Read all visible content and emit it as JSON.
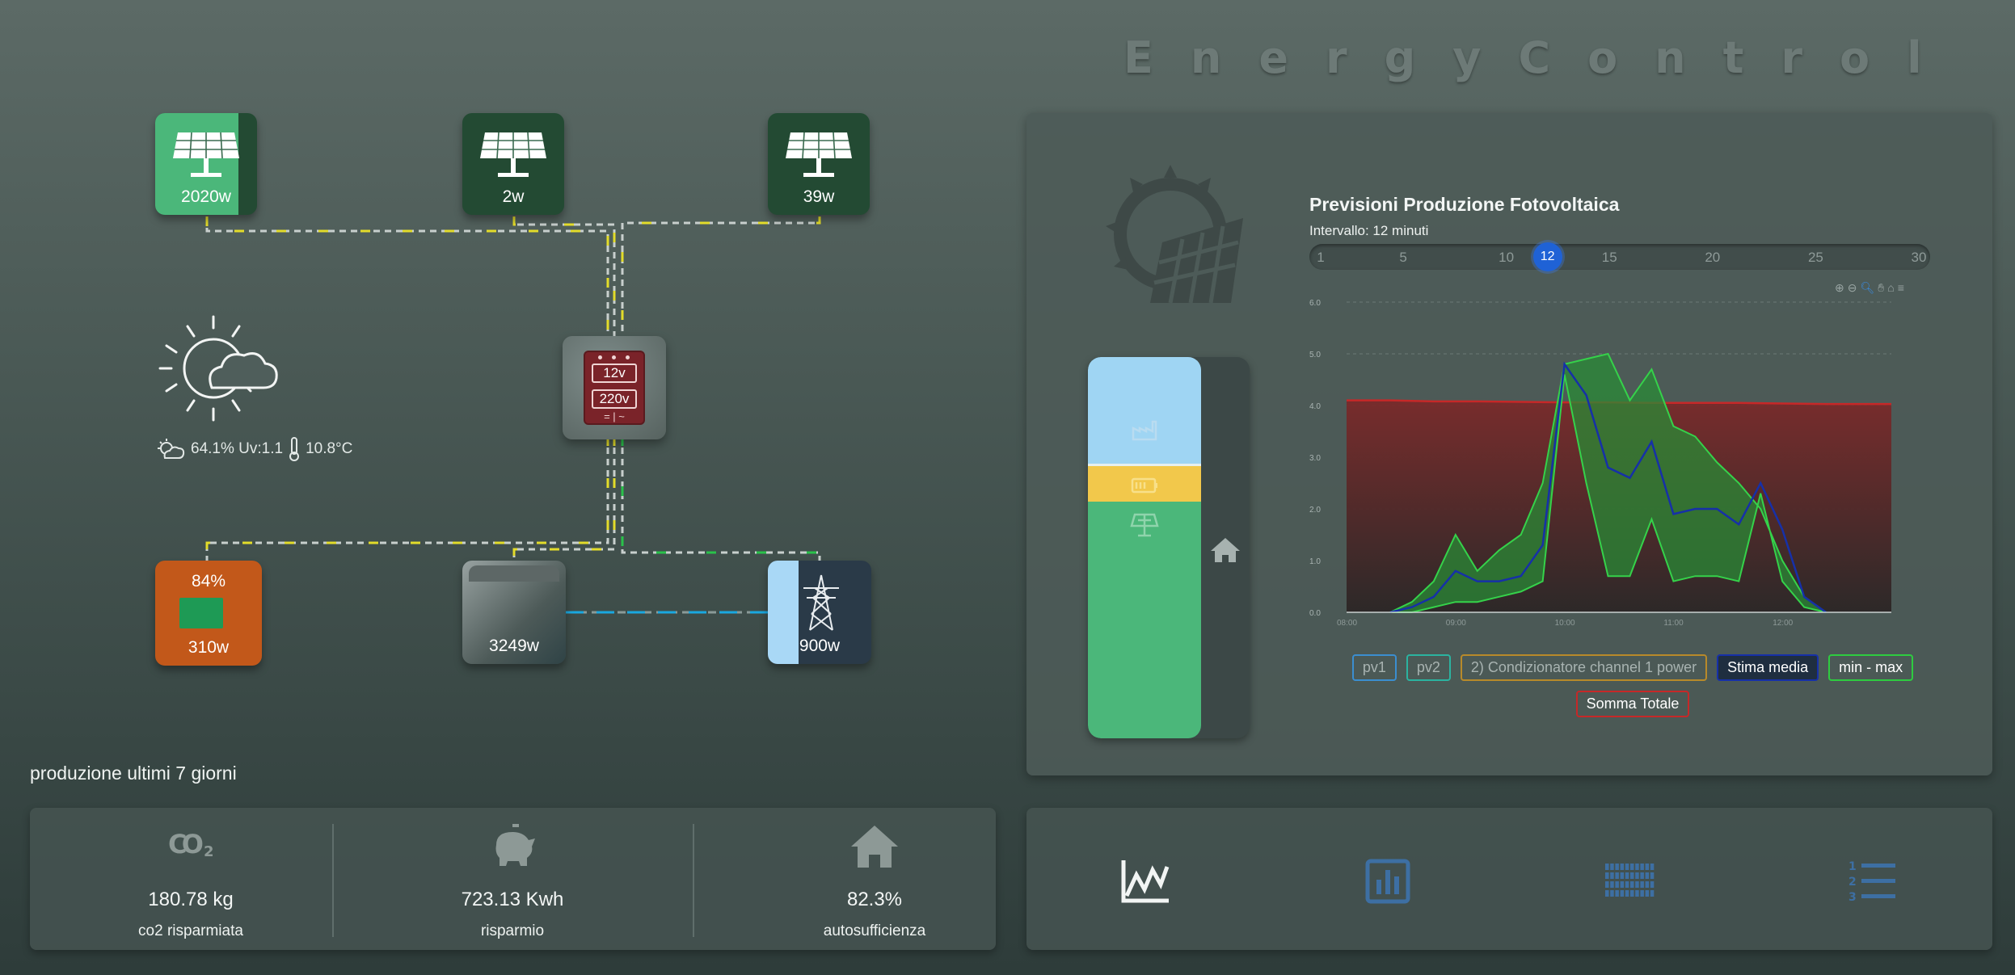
{
  "app": {
    "title": "EnergyControl"
  },
  "flow": {
    "panels": [
      {
        "value": "2020w",
        "fill": 0.82
      },
      {
        "value": "2w",
        "fill": 0.0
      },
      {
        "value": "39w",
        "fill": 0.0
      }
    ],
    "inverter": {
      "dc_label": "12v",
      "ac_label": "220v",
      "symbol": "= | ~"
    },
    "battery": {
      "percent": "84%",
      "value": "310w",
      "color": "#c2581a"
    },
    "house": {
      "value": "3249w"
    },
    "grid": {
      "value": "900w"
    },
    "weather": {
      "humidity_uv": "64.1% Uv:1.1",
      "temperature": "10.8°C",
      "icon": "partly-cloudy-sun-icon"
    }
  },
  "stats": {
    "label": "produzione ultimi 7 giorni",
    "items": [
      {
        "icon": "co2-icon",
        "value": "180.78 kg",
        "label": "co2 risparmiata"
      },
      {
        "icon": "piggy-bank-icon",
        "value": "723.13 Kwh",
        "label": "risparmio"
      },
      {
        "icon": "home-icon",
        "value": "82.3%",
        "label": "autosufficienza"
      }
    ]
  },
  "mix": {
    "segments": [
      {
        "name": "grid",
        "icon": "factory-icon",
        "fraction": 0.28,
        "color": "#9fd5f3"
      },
      {
        "name": "battery",
        "icon": "battery-icon",
        "fraction": 0.1,
        "color": "#f2c84b"
      },
      {
        "name": "solar",
        "icon": "solar-tower-icon",
        "fraction": 0.62,
        "color": "#4bb77a"
      }
    ]
  },
  "chart": {
    "title": "Previsioni Produzione Fotovoltaica",
    "interval_label": "Intervallo: 12 minuti",
    "slider": {
      "min": 1,
      "max": 30,
      "value": 12,
      "value_label": "12",
      "ticks": [
        "1",
        "5",
        "10",
        "15",
        "20",
        "25",
        "30"
      ],
      "tick_values": [
        1,
        5,
        10,
        15,
        20,
        25,
        30
      ]
    },
    "toolbar_icons": [
      "zoom-in-icon",
      "zoom-out-icon",
      "zoom-select-icon",
      "pan-icon",
      "reset-home-icon",
      "menu-icon"
    ]
  },
  "chart_data": {
    "type": "area",
    "ylim": [
      0,
      6.0
    ],
    "yticks": [
      "0.0",
      "1.0",
      "2.0",
      "3.0",
      "4.0",
      "5.0",
      "6.0"
    ],
    "xticks": [
      "08:00",
      "09:00",
      "10:00",
      "11:00",
      "12:00"
    ],
    "xlim": [
      0,
      25
    ],
    "series": [
      {
        "name": "Somma Totale",
        "color": "#c62828",
        "x": [
          0,
          2,
          4,
          6,
          8,
          10,
          12,
          14,
          16,
          18,
          20,
          22,
          24,
          25
        ],
        "y": [
          4.1,
          4.1,
          4.08,
          4.08,
          4.07,
          4.06,
          4.06,
          4.05,
          4.05,
          4.05,
          4.04,
          4.03,
          4.03,
          4.03
        ]
      },
      {
        "name": "min - max",
        "color": "#2ecc40",
        "x": [
          2,
          3,
          4,
          5,
          6,
          7,
          8,
          9,
          10,
          11,
          12,
          13,
          14,
          15,
          16,
          17,
          18,
          19,
          20,
          21,
          22
        ],
        "upper": [
          0.0,
          0.2,
          0.6,
          1.5,
          0.8,
          1.2,
          1.5,
          2.5,
          4.8,
          4.9,
          5.0,
          4.1,
          4.7,
          3.6,
          3.4,
          2.9,
          2.5,
          2.0,
          1.0,
          0.3,
          0.0
        ],
        "lower": [
          0.0,
          0.0,
          0.1,
          0.2,
          0.2,
          0.3,
          0.4,
          0.6,
          4.6,
          2.5,
          0.7,
          0.7,
          1.8,
          0.6,
          0.7,
          0.7,
          0.6,
          2.3,
          0.6,
          0.1,
          0.0
        ]
      },
      {
        "name": "Stima media",
        "color": "#1630a8",
        "x": [
          2,
          3,
          4,
          5,
          6,
          7,
          8,
          9,
          10,
          11,
          12,
          13,
          14,
          15,
          16,
          17,
          18,
          19,
          20,
          21,
          22
        ],
        "y": [
          0.0,
          0.1,
          0.3,
          0.8,
          0.6,
          0.6,
          0.7,
          1.3,
          4.8,
          4.2,
          2.8,
          2.6,
          3.3,
          1.9,
          2.0,
          2.0,
          1.7,
          2.5,
          1.6,
          0.3,
          0.0
        ]
      }
    ],
    "legend": [
      {
        "label": "pv1",
        "color": "#3b8ed0",
        "active": false
      },
      {
        "label": "pv2",
        "color": "#2bb3a0",
        "active": false
      },
      {
        "label": "2) Condizionatore channel 1 power",
        "color": "#b88a2a",
        "active": false
      },
      {
        "label": "Stima media",
        "color": "#1630a8",
        "active": true
      },
      {
        "label": "min - max",
        "color": "#2ecc40",
        "active": true
      },
      {
        "label": "Somma Totale",
        "color": "#c62828",
        "active": true
      }
    ]
  },
  "nav": {
    "buttons": [
      {
        "icon": "line-chart-icon",
        "active": true
      },
      {
        "icon": "bar-chart-icon",
        "active": false
      },
      {
        "icon": "heatmap-grid-icon",
        "active": false
      },
      {
        "icon": "numbered-list-icon",
        "active": false
      }
    ]
  },
  "colors": {
    "accent": "#1f62d6",
    "nav_icon": "#3d6fa3",
    "solar": "#4bb77a",
    "flow_solar": "#e3dc2a",
    "flow_grid": "#1aa8e0",
    "flow_green": "#29c24a"
  }
}
